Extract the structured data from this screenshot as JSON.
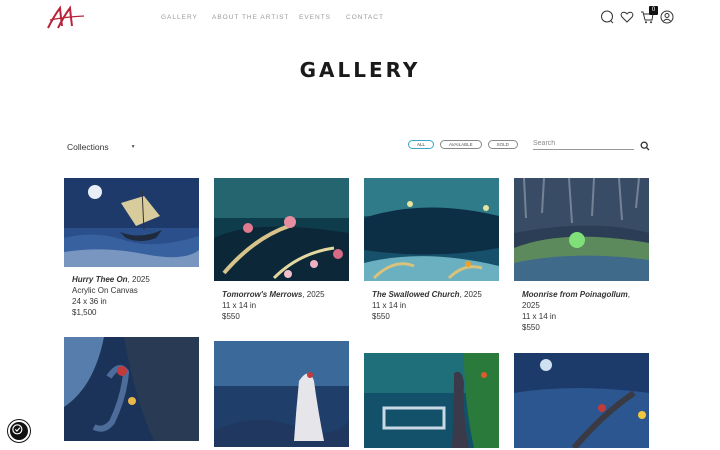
{
  "header": {
    "logo_alt": "AA",
    "nav": [
      "GALLERY",
      "ABOUT THE ARTIST",
      "EVENTS",
      "CONTACT"
    ],
    "cart_count": "0",
    "icons": [
      "search-icon",
      "heart-icon",
      "cart-icon",
      "account-icon"
    ]
  },
  "page": {
    "title": "GALLERY"
  },
  "filters": {
    "collections_label": "Collections",
    "pills": [
      "ALL",
      "AVAILABLE",
      "SOLD"
    ],
    "active": "ALL",
    "search_placeholder": "Search"
  },
  "artworks": [
    {
      "title": "Hurry Thee On",
      "year": ", 2025",
      "medium": "Acrylic On Canvas",
      "size": "24 x 36 in",
      "price": "$1,500"
    },
    {
      "title": "Tomorrow's Merrows",
      "year": ", 2025",
      "medium": "",
      "size": "11 x 14 in",
      "price": "$550"
    },
    {
      "title": "The Swallowed Church",
      "year": ", 2025",
      "medium": "",
      "size": "11 x 14 in",
      "price": "$550"
    },
    {
      "title": "Moonrise from Poinagollum",
      "year": ",",
      "year2": "2025",
      "medium": "",
      "size": "11 x 14 in",
      "price": "$550"
    }
  ],
  "colors": {
    "accent": "#3aa6c9",
    "logo": "#b8243a",
    "text": "#333333"
  }
}
